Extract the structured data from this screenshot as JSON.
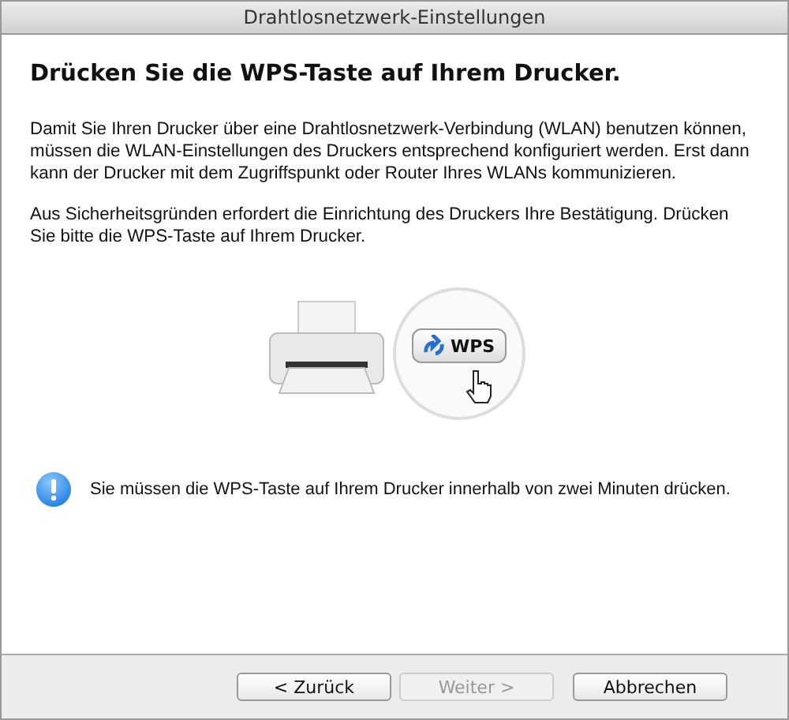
{
  "window": {
    "title": "Drahtlosnetzwerk-Einstellungen"
  },
  "heading": "Drücken Sie die WPS-Taste auf Ihrem Drucker.",
  "paragraphs": [
    "Damit Sie Ihren Drucker über eine Drahtlosnetzwerk-Verbindung (WLAN) benutzen können, müssen die WLAN-Einstellungen des Druckers entsprechend konfiguriert werden. Erst dann kann der Drucker mit dem Zugriffspunkt oder Router Ihres WLANs kommunizieren.",
    "Aus Sicherheitsgründen erfordert die Einrichtung des Druckers Ihre Bestätigung. Drücken Sie bitte die WPS-Taste auf Ihrem Drucker."
  ],
  "illustration": {
    "button_label": "WPS"
  },
  "notice": "Sie müssen die WPS-Taste auf Ihrem Drucker innerhalb von zwei Minuten drücken.",
  "buttons": [
    {
      "label": "< Zurück",
      "disabled": false
    },
    {
      "label": "Weiter >",
      "disabled": true
    },
    {
      "label": "Abbrechen",
      "disabled": false
    }
  ]
}
